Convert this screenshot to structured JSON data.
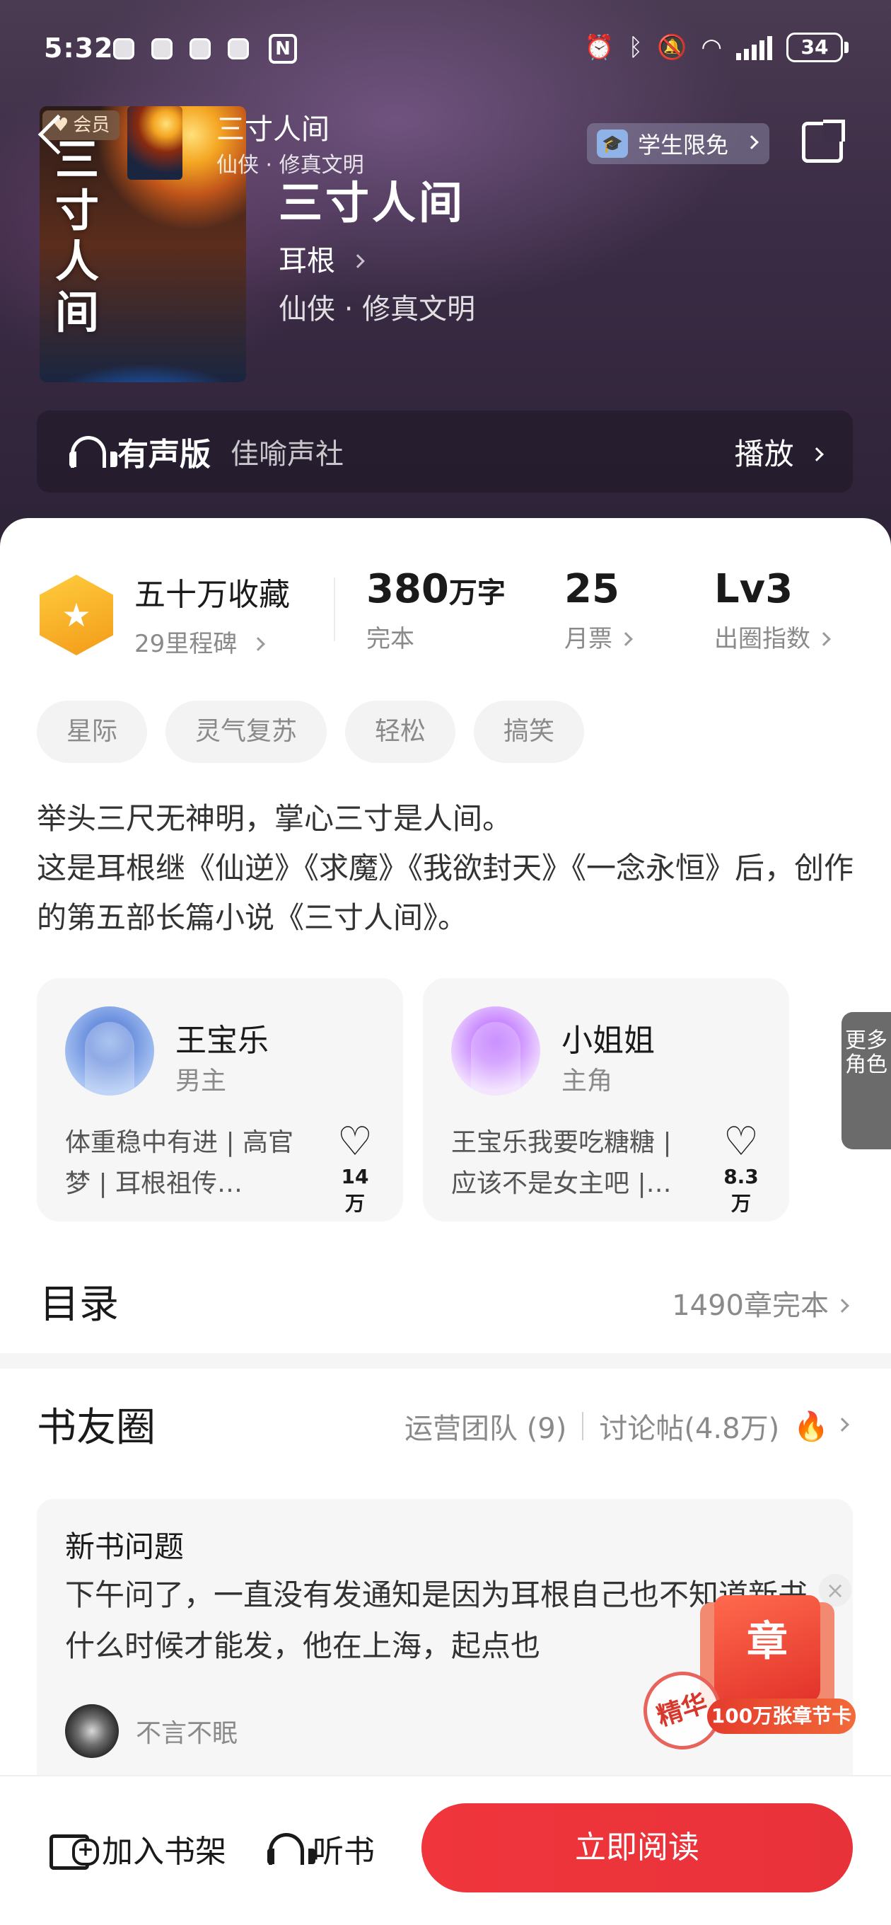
{
  "status_bar": {
    "time": "5:32",
    "nfc": "N",
    "battery": "34"
  },
  "header": {
    "vip_label": "会员",
    "mini_title": "三寸人间",
    "mini_subtitle": "仙侠 · 修真文明",
    "student_badge": "学生限免",
    "cover_text": "三寸人间"
  },
  "book": {
    "title": "三寸人间",
    "author": "耳根",
    "genre": "仙侠 · 修真文明"
  },
  "audio": {
    "label": "有声版",
    "studio": "佳喻声社",
    "play": "播放"
  },
  "stats": {
    "collect_title": "五十万收藏",
    "collect_sub": "29里程碑",
    "words_num": "380",
    "words_unit": "万字",
    "words_label": "完本",
    "tickets_num": "25",
    "tickets_label": "月票",
    "level_num": "Lv3",
    "level_label": "出圈指数"
  },
  "tags": [
    "星际",
    "灵气复苏",
    "轻松",
    "搞笑"
  ],
  "description": {
    "line1": "举头三尺无神明，掌心三寸是人间。",
    "line2": "这是耳根继《仙逆》《求魔》《我欲封天》《一念永恒》后，创作的第五部长篇小说《三寸人间》。"
  },
  "roles": [
    {
      "name": "王宝乐",
      "type": "男主",
      "tags": "体重稳中有进 | 高官梦 | 耳根祖传…",
      "likes": "14万"
    },
    {
      "name": "小姐姐",
      "type": "主角",
      "tags": "王宝乐我要吃糖糖 | 应该不是女主吧 |…",
      "likes": "8.3万"
    }
  ],
  "more_roles": "更多角色",
  "toc": {
    "title": "目录",
    "info": "1490章完本"
  },
  "circle": {
    "title": "书友圈",
    "team": "运营团队 (9)",
    "posts": "讨论帖(4.8万)"
  },
  "post": {
    "title": "新书问题",
    "body": "下午问了，一直没有发通知是因为耳根自己也不知道新书什么时候才能发，他在上海，起点也",
    "user": "不言不眠"
  },
  "promo": {
    "card": "章",
    "ribbon": "100万张章节卡",
    "stamp": "精华"
  },
  "bottom_bar": {
    "shelf": "加入书架",
    "listen": "听书",
    "read": "立即阅读"
  },
  "colors": {
    "accent_red": "#e8323a",
    "header_bg": "#3b2c45",
    "medal_gold": "#f39b19"
  }
}
